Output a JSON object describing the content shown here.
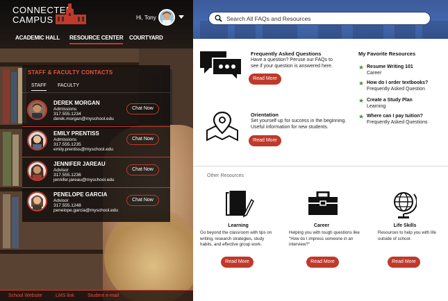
{
  "app": {
    "logo_line1": "CONNECTED",
    "logo_line2": "CAMPUS",
    "greeting": "Hi, Tony"
  },
  "nav": {
    "items": [
      {
        "label": "ACADEMIC HALL"
      },
      {
        "label": "RESOURCE CENTER"
      },
      {
        "label": "COURTYARD"
      }
    ]
  },
  "contacts": {
    "title": "STAFF & FACULTY CONTACTS",
    "tabs": [
      {
        "label": "STAFF"
      },
      {
        "label": "FACULTY"
      }
    ],
    "chat_label": "Chat Now",
    "people": [
      {
        "name": "DEREK MORGAN",
        "title": "Admissions",
        "phone": "317.555.1234",
        "email": "derek.morgan@myschool.edu"
      },
      {
        "name": "EMILY PRENTISS",
        "title": "Admissions",
        "phone": "317.555.1235",
        "email": "emily.prentiss@myschool.edu"
      },
      {
        "name": "JENNIFER JAREAU",
        "title": "Advisor",
        "phone": "317.555.1236",
        "email": "jennifer.jareau@myschool.edu"
      },
      {
        "name": "PENELOPE GARCIA",
        "title": "Advisor",
        "phone": "317.555.1248",
        "email": "penelope.garcia@myschool.edu"
      }
    ]
  },
  "footer": {
    "links": [
      {
        "label": "School Website"
      },
      {
        "label": "LMS link"
      },
      {
        "label": "Student e-mail"
      }
    ]
  },
  "search": {
    "placeholder": "Search All FAQs and Resources"
  },
  "featured": [
    {
      "title": "Frequently Asked Questions",
      "desc": "Have a question? Peruse our FAQs to see if your question is answered here.",
      "button": "Read More",
      "icon": "chat-bubbles-icon"
    },
    {
      "title": "Orientation",
      "desc": "Set yourself up for success in the beginning. Useful information for new students.",
      "button": "Read More",
      "icon": "map-pin-icon"
    }
  ],
  "favorites": {
    "title": "My Favorite Resources",
    "items": [
      {
        "title": "Resume Writing 101",
        "sub": "Career"
      },
      {
        "title": "How do I order textbooks?",
        "sub": "Frequently Asked Question"
      },
      {
        "title": "Create a Study Plan",
        "sub": "Learning"
      },
      {
        "title": "Where can I pay tuition?",
        "sub": "Frequently Asked Questions"
      }
    ]
  },
  "other": {
    "label": "Other Resources",
    "items": [
      {
        "title": "Learning",
        "desc": "Go beyond the classroom with tips on writing, research strategies, study habits, and effective group work.",
        "button": "Read More",
        "icon": "notebook-pencil-icon"
      },
      {
        "title": "Career",
        "desc": "Helping you with tough questions like \"How do I impress someone in an interview?\"",
        "button": "Read More",
        "icon": "briefcase-icon"
      },
      {
        "title": "Life Skills",
        "desc": "Resources to help you with life outside of school.",
        "button": "Read More",
        "icon": "globe-icon"
      }
    ]
  },
  "colors": {
    "accent": "#c0392b",
    "header_blue": "#4469b0",
    "star_green": "#4f8f3a"
  }
}
